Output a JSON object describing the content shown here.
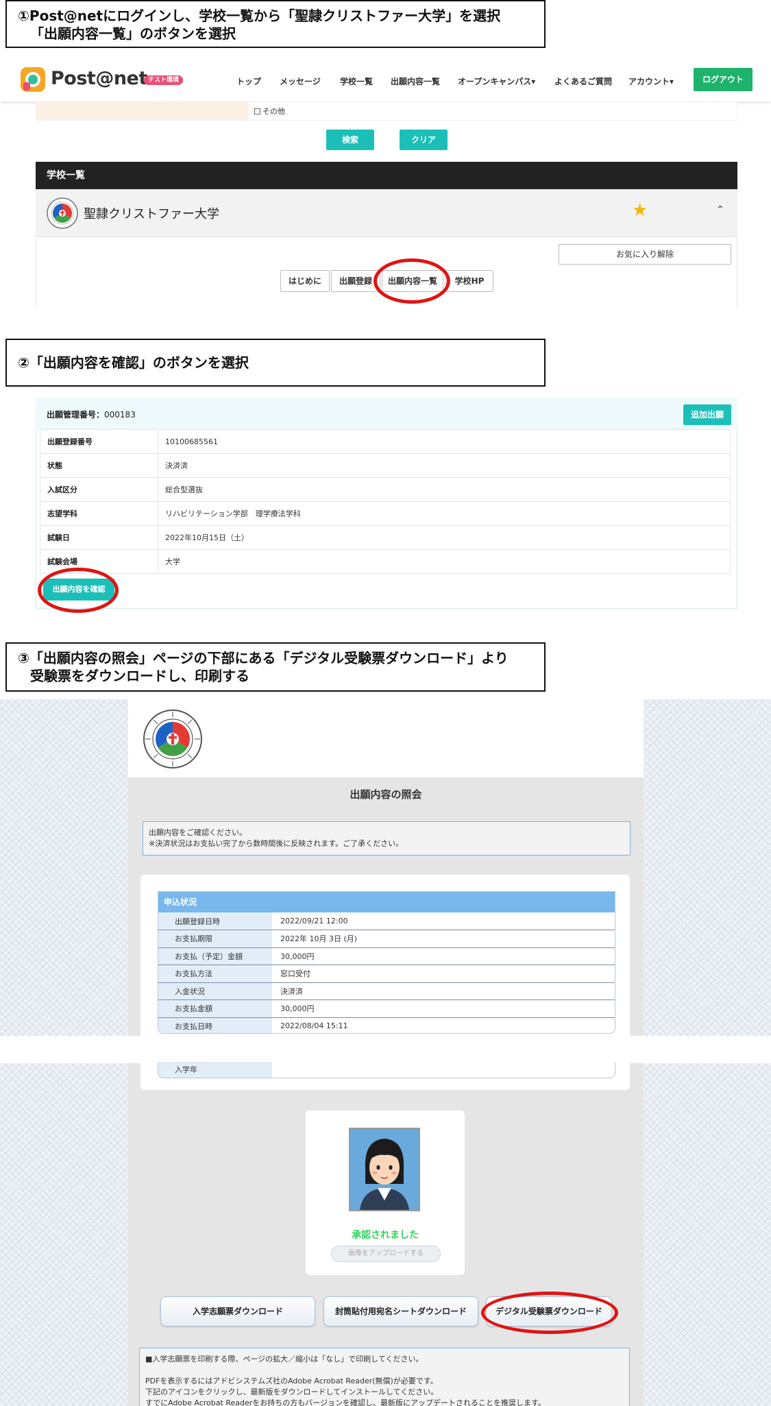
{
  "steps": {
    "step1_line1": "①Post@netにログインし、学校一覧から「聖隷クリストファー大学」を選択",
    "step1_line2": "「出願内容一覧」のボタンを選択",
    "step2": "②「出願内容を確認」のボタンを選択",
    "step3_line1": "③「出願内容の照会」ページの下部にある「デジタル受験票ダウンロード」より",
    "step3_line2": "受験票をダウンロードし、印刷する"
  },
  "header": {
    "brand": "Post@net",
    "badge": "テスト環境",
    "nav": [
      "トップ",
      "メッセージ",
      "学校一覧",
      "出願内容一覧",
      "オープンキャンパス▾",
      "よくあるご質問",
      "アカウント▾"
    ],
    "logout": "ログアウト"
  },
  "search": {
    "other_option": "その他",
    "search_btn": "検索",
    "clear_btn": "クリア"
  },
  "school_list": {
    "header": "学校一覧",
    "university": "聖隷クリストファー大学",
    "fav_remove": "お気に入り解除",
    "buttons": [
      "はじめに",
      "出願登録",
      "出願内容一覧",
      "学校HP"
    ]
  },
  "application": {
    "mgmt_label": "出願管理番号：",
    "mgmt_number": "000183",
    "add_btn": "追加出願",
    "rows": [
      {
        "k": "出願登録番号",
        "v": "10100685561"
      },
      {
        "k": "状態",
        "v": "決済済"
      },
      {
        "k": "入試区分",
        "v": "総合型選抜"
      },
      {
        "k": "志望学科",
        "v": "リハビリテーション学部　理学療法学科"
      },
      {
        "k": "試験日",
        "v": "2022年10月15日（土）"
      },
      {
        "k": "試験会場",
        "v": "大学"
      }
    ],
    "confirm_btn": "出願内容を確認"
  },
  "inquiry": {
    "title": "出願内容の照会",
    "notice_line1": "出願内容をご確認ください。",
    "notice_line2": "※決済状況はお支払い完了から数時間後に反映されます。ご了承ください。",
    "status_header": "申込状況",
    "status_rows": [
      {
        "k": "出願登録日時",
        "v": "2022/09/21 12:00"
      },
      {
        "k": "お支払期限",
        "v": "2022年 10月 3日 (月)"
      },
      {
        "k": "お支払（予定）金額",
        "v": "30,000円"
      },
      {
        "k": "お支払方法",
        "v": "窓口受付"
      },
      {
        "k": "入金状況",
        "v": "決済済"
      },
      {
        "k": "お支払金額",
        "v": "30,000円"
      },
      {
        "k": "お支払日時",
        "v": "2022/08/04 15:11"
      }
    ],
    "extra_row": "入学年",
    "approved": "承認されました",
    "upload_btn": "画像をアップロードする",
    "downloads": [
      "入学志願票ダウンロード",
      "封筒貼付用宛名シートダウンロード",
      "デジタル受験票ダウンロード"
    ],
    "info_line1": "■入学志願票を印刷する際、ページの拡大／縮小は「なし」で印刷してください。",
    "info_line2": "PDFを表示するにはアドビシステムズ社のAdobe Acrobat Reader(無償)が必要です。",
    "info_line3": "下記のアイコンをクリックし、最新版をダウンロードしてインストールしてください。",
    "info_line4": "すでにAdobe Acrobat Readerをお持ちの方もバージョンを確認し、最新版にアップデートされることを推奨します。"
  },
  "colors": {
    "teal": "#1cbfb8",
    "logout_green": "#1db36b",
    "highlight_red": "#e01414",
    "status_blue": "#78b8ec",
    "approved_green": "#31d45a"
  }
}
